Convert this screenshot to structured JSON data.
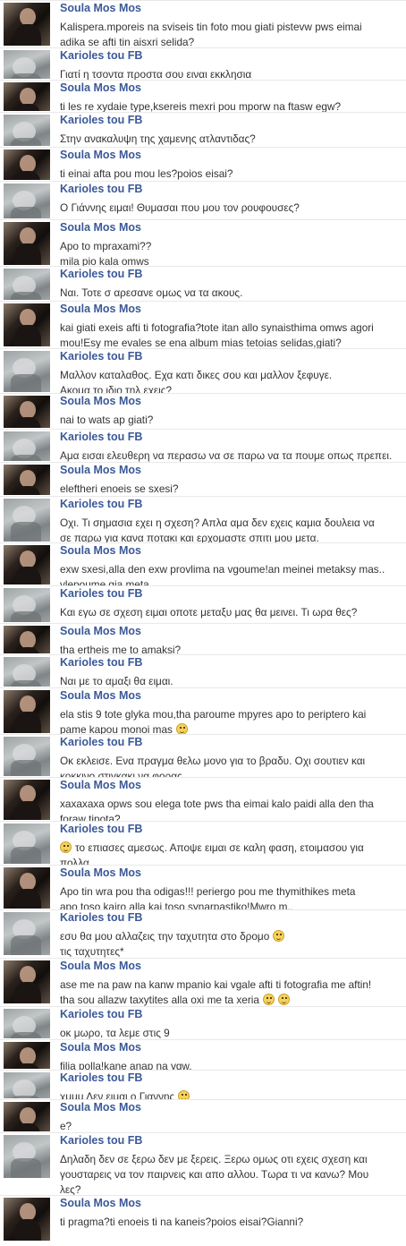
{
  "colors": {
    "name": "#3b5998",
    "text": "#333333",
    "divider": "#e9e9e9"
  },
  "participants": {
    "a": "Soula Mos Mos",
    "b": "Karioles tou FB"
  },
  "messages": [
    {
      "sender": "Soula Mos Mos",
      "lines": [
        "Kalispera.mporeis na sviseis tin foto mou giati pistevw pws eimai",
        "adika se afti tin aisxri selida?"
      ]
    },
    {
      "sender": "Karioles tou FB",
      "lines": [
        "Γιατί η τσοντα προστα σου ειναι εκκλησια"
      ]
    },
    {
      "sender": "Soula Mos Mos",
      "lines": [
        "ti les re xydaie type,ksereis mexri pou mporw na ftasw egw?"
      ]
    },
    {
      "sender": "Karioles tou FB",
      "lines": [
        "Στην ανακαλυψη της χαμενης ατλαντιδας?"
      ]
    },
    {
      "sender": "Soula Mos Mos",
      "lines": [
        "ti einai afta pou mou les?poios eisai?"
      ]
    },
    {
      "sender": "Karioles tou FB",
      "lines": [
        "Ο Γιάννης ειμαι! Θυμασαι που μου τον ρουφουσες?"
      ]
    },
    {
      "sender": "Soula Mos Mos",
      "lines": [
        "Apo to mpraxami??",
        "mila pio kala omws"
      ]
    },
    {
      "sender": "Karioles tou FB",
      "lines": [
        "Ναι. Τοτε σ αρεσανε ομως να τα ακους."
      ]
    },
    {
      "sender": "Soula Mos Mos",
      "lines": [
        "kai giati exeis afti ti fotografia?tote itan allo synaisthima omws agori",
        "mou!Esy me evales se ena album mias tetoias selidas,giati?"
      ]
    },
    {
      "sender": "Karioles tou FB",
      "lines": [
        "Μαλλον καταλαθος. Εχα κατι δικες σου και μαλλον ξεφυγε.",
        "Ακομα το ιδιο τηλ εχεις?"
      ]
    },
    {
      "sender": "Soula Mos Mos",
      "lines": [
        "nai to wats ap giati?"
      ]
    },
    {
      "sender": "Karioles tou FB",
      "lines": [
        "Αμα εισαι ελευθερη να περασω να σε παρω να τα πουμε οπως πρεπει."
      ]
    },
    {
      "sender": "Soula Mos Mos",
      "lines": [
        "eleftheri enoeis se sxesi?"
      ]
    },
    {
      "sender": "Karioles tou FB",
      "lines": [
        "Οχι. Τι σημασια εχει η σχεση? Απλα αμα δεν εχεις καμια δουλεια να",
        "σε παρω για κανα ποτακι και ερχομαστε σπιτι μου μετα."
      ]
    },
    {
      "sender": "Soula Mos Mos",
      "lines": [
        "exw sxesi,alla den exw provlima na vgoume!an meinei metaksy mas..",
        "vlepoume gia meta"
      ]
    },
    {
      "sender": "Karioles tou FB",
      "lines": [
        "Και εγω σε σχεση ειμαι οποτε μεταξυ μας θα μεινει. Τι ωρα θες?"
      ]
    },
    {
      "sender": "Soula Mos Mos",
      "lines": [
        "tha ertheis me to amaksi?"
      ]
    },
    {
      "sender": "Karioles tou FB",
      "lines": [
        "Ναι με το αμαξι θα ειμαι."
      ]
    },
    {
      "sender": "Soula Mos Mos",
      "lines": [
        "ela stis 9 tote glyka mou,tha paroume mpyres apo to periptero kai",
        "pame kapou monoi mas"
      ],
      "emoji": "smile"
    },
    {
      "sender": "Karioles tou FB",
      "lines": [
        "Οκ εκλεισε. Ενα πραγμα θελω μονο για το βραδυ. Οχι σουτιεν και",
        "κοκκινο στιγκακι να φορας."
      ]
    },
    {
      "sender": "Soula Mos Mos",
      "lines": [
        "xaxaxaxa opws sou elega tote pws tha eimai kalo paidi alla den tha",
        "foraw tipota?"
      ]
    },
    {
      "sender": "Karioles tou FB",
      "lines": [
        "το επιασες αμεσως. Αποψε ειμαι σε καλη φαση, ετοιμασου για",
        "πολλα."
      ],
      "emoji_lead": "blush"
    },
    {
      "sender": "Soula Mos Mos",
      "lines": [
        "Apo tin wra pou tha odigas!!! periergo pou me thymithikes meta",
        "apo toso kairo alla kai toso synarpastiko!Mwro m.."
      ]
    },
    {
      "sender": "Karioles tou FB",
      "lines": [
        "εσυ θα μου αλλαζεις την ταχυτητα στο δρομο",
        "τις ταχυτητες*"
      ],
      "emoji": "smile"
    },
    {
      "sender": "Soula Mos Mos",
      "lines": [
        "ase me na paw na kanw mpanio kai vgale afti ti fotografia me aftin!",
        "tha sou allazw taxytites alla oxi me ta xeria"
      ],
      "emoji": "smile wink"
    },
    {
      "sender": "Karioles tou FB",
      "lines": [
        "οκ μωρο, τα λεμε στις 9"
      ]
    },
    {
      "sender": "Soula Mos Mos",
      "lines": [
        "filia polla!kane anap na vgw."
      ]
    },
    {
      "sender": "Karioles tou FB",
      "lines": [
        "χμμμ Δεν ειμαι ο Γιαννης"
      ],
      "emoji": "blush"
    },
    {
      "sender": "Soula Mos Mos",
      "lines": [
        "e?"
      ]
    },
    {
      "sender": "Karioles tou FB",
      "lines": [
        "Δηλαδη δεν σε ξερω δεν με ξερεις. Ξερω ομως οτι εχεις σχεση και",
        "γουσταρεις να τον παιρνεις και απο αλλου. Τωρα τι να κανω? Μου",
        "λες?"
      ]
    },
    {
      "sender": "Soula Mos Mos",
      "lines": [
        "ti pragma?ti enoeis ti na kaneis?poios eisai?Gianni?"
      ]
    }
  ]
}
